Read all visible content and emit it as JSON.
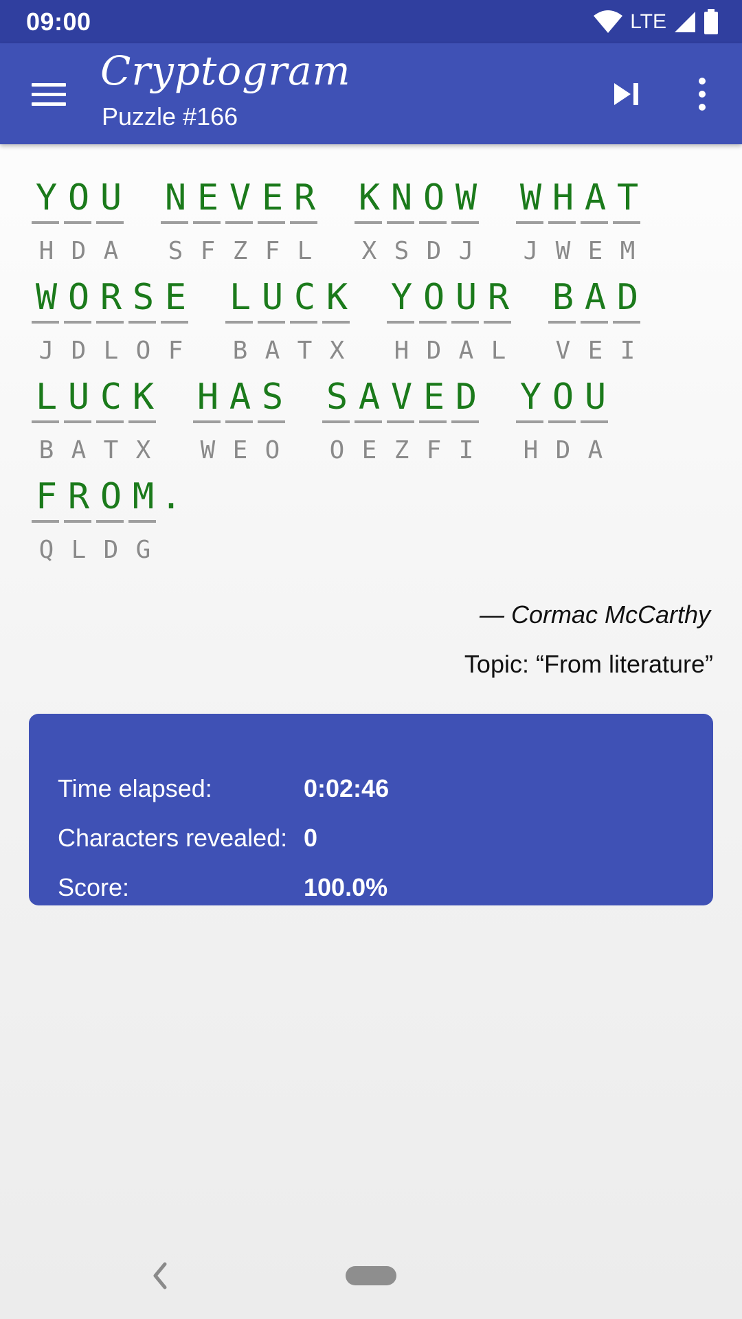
{
  "status_bar": {
    "time": "09:00",
    "network": "LTE"
  },
  "app_bar": {
    "title": "Cryptogram",
    "subtitle": "Puzzle #166",
    "icons": [
      "menu-icon",
      "skip-next-icon",
      "more-vert-icon"
    ]
  },
  "puzzle": {
    "lines": [
      [
        [
          [
            "Y",
            "H"
          ],
          [
            "O",
            "D"
          ],
          [
            "U",
            "A"
          ]
        ],
        [
          [
            "N",
            "S"
          ],
          [
            "E",
            "F"
          ],
          [
            "V",
            "Z"
          ],
          [
            "E",
            "F"
          ],
          [
            "R",
            "L"
          ]
        ],
        [
          [
            "K",
            "X"
          ],
          [
            "N",
            "S"
          ],
          [
            "O",
            "D"
          ],
          [
            "W",
            "J"
          ]
        ],
        [
          [
            "W",
            "J"
          ],
          [
            "H",
            "W"
          ],
          [
            "A",
            "E"
          ],
          [
            "T",
            "M"
          ]
        ]
      ],
      [
        [
          [
            "W",
            "J"
          ],
          [
            "O",
            "D"
          ],
          [
            "R",
            "L"
          ],
          [
            "S",
            "O"
          ],
          [
            "E",
            "F"
          ]
        ],
        [
          [
            "L",
            "B"
          ],
          [
            "U",
            "A"
          ],
          [
            "C",
            "T"
          ],
          [
            "K",
            "X"
          ]
        ],
        [
          [
            "Y",
            "H"
          ],
          [
            "O",
            "D"
          ],
          [
            "U",
            "A"
          ],
          [
            "R",
            "L"
          ]
        ],
        [
          [
            "B",
            "V"
          ],
          [
            "A",
            "E"
          ],
          [
            "D",
            "I"
          ]
        ]
      ],
      [
        [
          [
            "L",
            "B"
          ],
          [
            "U",
            "A"
          ],
          [
            "C",
            "T"
          ],
          [
            "K",
            "X"
          ]
        ],
        [
          [
            "H",
            "W"
          ],
          [
            "A",
            "E"
          ],
          [
            "S",
            "O"
          ]
        ],
        [
          [
            "S",
            "O"
          ],
          [
            "A",
            "E"
          ],
          [
            "V",
            "Z"
          ],
          [
            "E",
            "F"
          ],
          [
            "D",
            "I"
          ]
        ],
        [
          [
            "Y",
            "H"
          ],
          [
            "O",
            "D"
          ],
          [
            "U",
            "A"
          ]
        ]
      ],
      [
        [
          [
            "F",
            "Q"
          ],
          [
            "R",
            "L"
          ],
          [
            "O",
            "D"
          ],
          [
            "M",
            "G"
          ],
          [
            "."
          ]
        ]
      ]
    ],
    "author": "— Cormac McCarthy",
    "topic": "Topic: “From literature”"
  },
  "stats": {
    "rows": [
      {
        "label": "Time elapsed:",
        "value": "0:02:46"
      },
      {
        "label": "Characters revealed:",
        "value": "0"
      },
      {
        "label": "Score:",
        "value": "100.0%"
      }
    ]
  },
  "nav_bar": {
    "icons": [
      "back-icon",
      "home-pill-icon"
    ]
  },
  "colors": {
    "primary": "#3f51b5",
    "primary_dark": "#303f9f",
    "solved_letter": "#1b7a1b",
    "cipher_letter": "#8a8a8a"
  }
}
